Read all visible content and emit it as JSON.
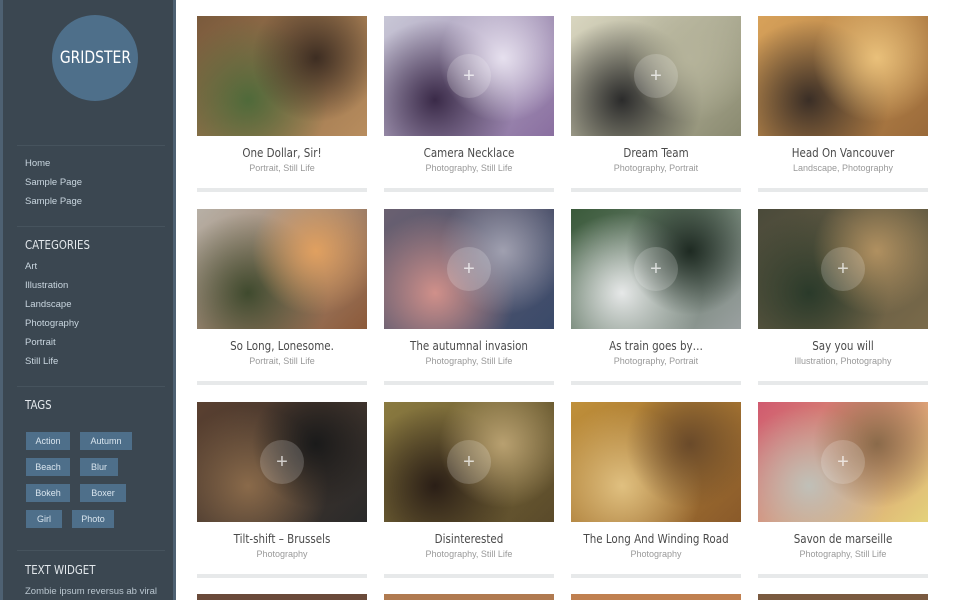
{
  "site": {
    "logo_text": "GRIDSTER"
  },
  "sidebar": {
    "pages": [
      {
        "label": "Home"
      },
      {
        "label": "Sample Page"
      },
      {
        "label": "Sample Page"
      }
    ],
    "categories_heading": "CATEGORIES",
    "categories": [
      {
        "label": "Art"
      },
      {
        "label": "Illustration"
      },
      {
        "label": "Landscape"
      },
      {
        "label": "Photography"
      },
      {
        "label": "Portrait"
      },
      {
        "label": "Still Life"
      }
    ],
    "tags_heading": "TAGS",
    "tags": [
      {
        "label": "Action"
      },
      {
        "label": "Autumn"
      },
      {
        "label": "Beach"
      },
      {
        "label": "Blur"
      },
      {
        "label": "Bokeh"
      },
      {
        "label": "Boxer"
      },
      {
        "label": "Girl"
      },
      {
        "label": "Photo"
      }
    ],
    "text_widget_heading": "TEXT WIDGET",
    "text_widget_body": "Zombie ipsum reversus ab viral"
  },
  "posts": [
    {
      "title": "One Dollar, Sir!",
      "categories": "Portrait, Still Life",
      "colors": [
        "#7a5a3c",
        "#b88d5e",
        "#4f6a3a",
        "#3d2d22"
      ]
    },
    {
      "title": "Camera Necklace",
      "categories": "Photography, Still Life",
      "colors": [
        "#c8c7d6",
        "#8a6fa0",
        "#3a2a48",
        "#e6e0ee"
      ]
    },
    {
      "title": "Dream Team",
      "categories": "Photography, Portrait",
      "colors": [
        "#d9d6c0",
        "#8a8a70",
        "#2b2b2b",
        "#b5b39a"
      ]
    },
    {
      "title": "Head On Vancouver",
      "categories": "Landscape, Photography",
      "colors": [
        "#d8a25a",
        "#9a6a3a",
        "#3a2e26",
        "#e9c07a"
      ]
    },
    {
      "title": "So Long, Lonesome.",
      "categories": "Portrait, Still Life",
      "colors": [
        "#b7b0a6",
        "#8c5a3a",
        "#3f4a2e",
        "#e0a060"
      ]
    },
    {
      "title": "The autumnal invasion",
      "categories": "Photography, Still Life",
      "colors": [
        "#6a6070",
        "#3a4a6a",
        "#d0908a",
        "#a0a0b0"
      ]
    },
    {
      "title": "As train goes by…",
      "categories": "Photography, Portrait",
      "colors": [
        "#3a5a3a",
        "#9aa0a0",
        "#e6e8e8",
        "#1e2a22"
      ]
    },
    {
      "title": "Say you will",
      "categories": "Illustration, Photography",
      "colors": [
        "#4a4a3a",
        "#7a6a4a",
        "#2a3a2a",
        "#b09060"
      ]
    },
    {
      "title": "Tilt-shift – Brussels",
      "categories": "Photography",
      "colors": [
        "#5a4030",
        "#2a2a2a",
        "#8a6a4a",
        "#1a1a1a"
      ]
    },
    {
      "title": "Disinterested",
      "categories": "Photography, Still Life",
      "colors": [
        "#8a7a40",
        "#5a4a2a",
        "#2a1e16",
        "#b8a070"
      ]
    },
    {
      "title": "The Long And Winding Road",
      "categories": "Photography",
      "colors": [
        "#c0903a",
        "#8a5a2a",
        "#e0c080",
        "#6a4a2a"
      ]
    },
    {
      "title": "Savon de marseille",
      "categories": "Photography, Still Life",
      "colors": [
        "#d05a70",
        "#e4d27a",
        "#c0c0b8",
        "#8a6a4a"
      ]
    }
  ]
}
